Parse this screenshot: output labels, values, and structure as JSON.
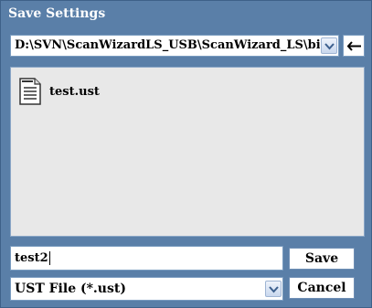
{
  "dialog": {
    "title": "Save Settings"
  },
  "path_bar": {
    "current_path": "D:\\SVN\\ScanWizardLS_USB\\ScanWizard_LS\\bin\\",
    "dropdown_icon": "chevron-down-icon",
    "back_icon": "arrow-left-icon"
  },
  "file_list": {
    "items": [
      {
        "name": "test.ust",
        "icon": "document-icon"
      }
    ]
  },
  "filename_field": {
    "value": "test2"
  },
  "file_type": {
    "selected": "UST File (*.ust)"
  },
  "buttons": {
    "save_label": "Save",
    "cancel_label": "Cancel"
  },
  "colors": {
    "frame": "#5a7fa8",
    "list_background": "#e8e8e8",
    "field_border": "#7a9cc0"
  }
}
